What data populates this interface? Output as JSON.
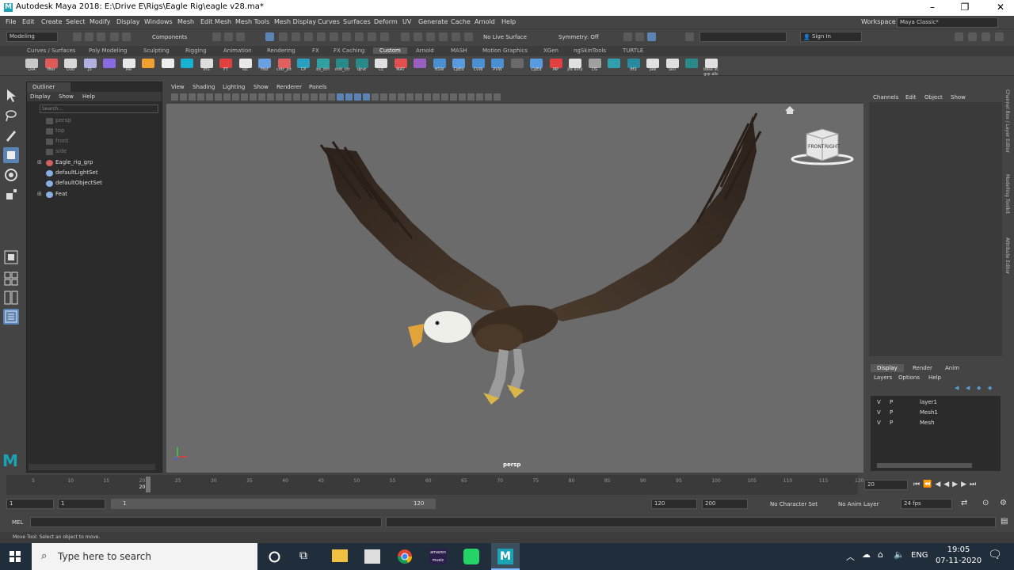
{
  "window": {
    "title": "Autodesk Maya 2018: E:\\Drive E\\Rigs\\Eagle Rig\\eagle v28.ma*",
    "app_icon": "maya-logo-icon"
  },
  "menu": [
    "File",
    "Edit",
    "Create",
    "Select",
    "Modify",
    "Display",
    "Windows",
    "Mesh",
    "Edit Mesh",
    "Mesh Tools",
    "Mesh Display",
    "Curves",
    "Surfaces",
    "Deform",
    "UV",
    "Generate",
    "Cache",
    "Arnold",
    "Help"
  ],
  "workspace": {
    "label": "Workspace :",
    "value": "Maya Classic*"
  },
  "status": {
    "mode": "Modeling",
    "components": "Components",
    "live_surface": "No Live Surface",
    "symmetry": "Symmetry: Off",
    "sign_in": "Sign In"
  },
  "shelf_tabs": [
    "Curves / Surfaces",
    "Poly Modeling",
    "Sculpting",
    "Rigging",
    "Animation",
    "Rendering",
    "FX",
    "FX Caching",
    "Custom",
    "Arnold",
    "MASH",
    "Motion Graphics",
    "XGen",
    "ngSkinTools",
    "TURTLE"
  ],
  "shelf_active": "Custom",
  "shelf_buttons": [
    "LRA",
    "Hier",
    "Outl",
    "JS",
    "",
    "MR",
    "",
    "",
    "",
    "IHS",
    "FT",
    "loc",
    "Hist",
    "cntr_jnt",
    "CP",
    "bs_ctrl",
    "mlti_ctr",
    "djrvt",
    "CE",
    "MAT",
    "",
    "HSW",
    "CpEd",
    "CVW",
    "PVW",
    "",
    "CpEd",
    "MP",
    "jnt evry",
    "DS",
    "",
    "IHS",
    "jaw",
    "Skn",
    "",
    "base sc grp allc"
  ],
  "outliner": {
    "tab": "Outliner",
    "menu": [
      "Display",
      "Show",
      "Help"
    ],
    "search_placeholder": "Search...",
    "items": [
      {
        "label": "persp",
        "dim": true
      },
      {
        "label": "top",
        "dim": true
      },
      {
        "label": "front",
        "dim": true
      },
      {
        "label": "side",
        "dim": true
      },
      {
        "label": "Eagle_rig_grp",
        "dim": false
      },
      {
        "label": "defaultLightSet",
        "dim": false
      },
      {
        "label": "defaultObjectSet",
        "dim": false
      },
      {
        "label": "Feat",
        "dim": false
      }
    ]
  },
  "viewport": {
    "menu": [
      "View",
      "Shading",
      "Lighting",
      "Show",
      "Renderer",
      "Panels"
    ],
    "camera": "persp",
    "viewcube": {
      "front": "FRONT",
      "right": "RIGHT"
    }
  },
  "channel_box": {
    "menu": [
      "Channels",
      "Edit",
      "Object",
      "Show"
    ]
  },
  "layer_editor": {
    "tabs": [
      "Display",
      "Render",
      "Anim"
    ],
    "menu": [
      "Layers",
      "Options",
      "Help"
    ],
    "layers": [
      {
        "v": "V",
        "p": "P",
        "name": "layer1"
      },
      {
        "v": "V",
        "p": "P",
        "name": "Mesh1"
      },
      {
        "v": "V",
        "p": "P",
        "name": "Mesh"
      }
    ]
  },
  "side_tabs": [
    "Channel Box / Layer Editor",
    "Modelling Toolkit",
    "Attribute Editor"
  ],
  "timeline": {
    "ticks": [
      "5",
      "10",
      "15",
      "20",
      "25",
      "30",
      "35",
      "40",
      "45",
      "50",
      "55",
      "60",
      "65",
      "70",
      "75",
      "80",
      "85",
      "90",
      "95",
      "100",
      "105",
      "110",
      "115",
      "120"
    ],
    "current_frame": "20",
    "current_field": "20"
  },
  "range": {
    "start": "1",
    "playback_start": "1",
    "slider_start": "1",
    "slider_end": "120",
    "playback_end": "120",
    "end": "200",
    "character_set": "No Character Set",
    "anim_layer": "No Anim Layer",
    "fps": "24 fps"
  },
  "mel": {
    "label": "MEL"
  },
  "helpline": "Move Tool: Select an object to move.",
  "taskbar": {
    "search_placeholder": "Type here to search",
    "lang": "ENG",
    "time": "19:05",
    "date": "07-11-2020"
  }
}
